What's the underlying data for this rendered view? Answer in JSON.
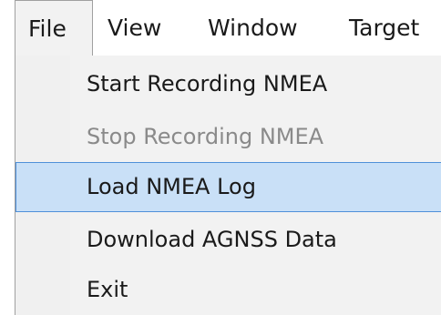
{
  "menubar": {
    "items": [
      {
        "label": "File"
      },
      {
        "label": "View"
      },
      {
        "label": "Window"
      },
      {
        "label": "Target"
      }
    ]
  },
  "file_menu": {
    "items": [
      {
        "label": "Start Recording NMEA",
        "state": "normal"
      },
      {
        "label": "Stop Recording NMEA",
        "state": "disabled"
      },
      {
        "label": "Load NMEA Log",
        "state": "highlighted"
      },
      {
        "label": "Download AGNSS Data",
        "state": "normal"
      },
      {
        "label": "Exit",
        "state": "normal"
      }
    ]
  },
  "colors": {
    "highlight_fill": "#c9e0f7",
    "highlight_border": "#4f90d9",
    "disabled_text": "#8a8a8a"
  }
}
